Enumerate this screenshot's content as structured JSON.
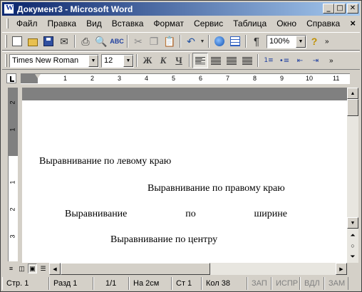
{
  "window": {
    "title": "Документ3 - Microsoft Word",
    "buttons": {
      "minimize": "_",
      "maximize": "□",
      "close": "✕"
    }
  },
  "menu": {
    "items": [
      "Файл",
      "Правка",
      "Вид",
      "Вставка",
      "Формат",
      "Сервис",
      "Таблица",
      "Окно",
      "Справка"
    ],
    "close_glyph": "×"
  },
  "standard_toolbar": {
    "zoom_value": "100%"
  },
  "formatting_toolbar": {
    "font_name": "Times New Roman",
    "font_size": "12",
    "bold_label": "Ж",
    "italic_label": "К",
    "underline_label": "Ч"
  },
  "ruler": {
    "horizontal_numbers": [
      "1",
      "2",
      "3",
      "4",
      "5",
      "6",
      "7",
      "8",
      "9",
      "10",
      "11"
    ],
    "vertical_numbers": [
      "2",
      "1",
      "1",
      "2",
      "3"
    ]
  },
  "document": {
    "paragraphs": [
      {
        "id": "left",
        "text": "Выравнивание по левому краю"
      },
      {
        "id": "right",
        "text": "Выравнивание по правому краю"
      },
      {
        "id": "justify",
        "words": [
          "Выравнивание",
          "по",
          "ширине"
        ]
      },
      {
        "id": "center",
        "text": "Выравнивание по центру"
      }
    ]
  },
  "status_bar": {
    "page": "Стр. 1",
    "section": "Разд 1",
    "pages": "1/1",
    "position": "На 2см",
    "line": "Ст 1",
    "column": "Кол 38",
    "rec": "ЗАП",
    "trk": "ИСПР",
    "ext": "ВДЛ",
    "ovr": "ЗАМ"
  },
  "colors": {
    "titlebar_start": "#0a246a",
    "titlebar_end": "#a6caf0",
    "chrome": "#d4d0c8"
  }
}
